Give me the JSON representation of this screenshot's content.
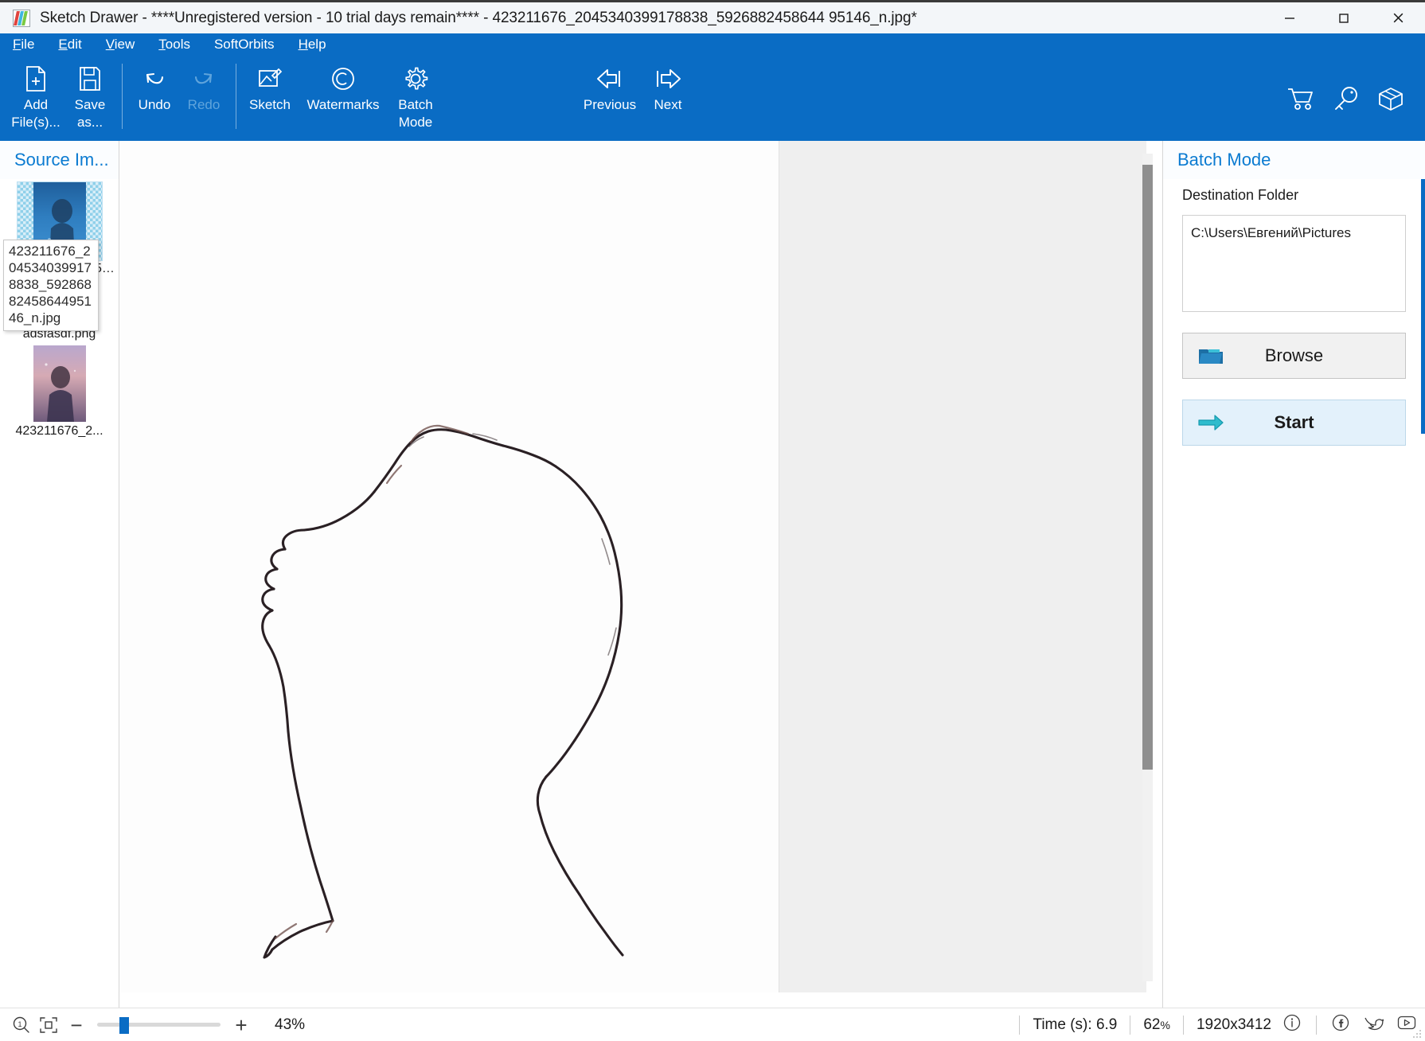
{
  "window": {
    "title": "Sketch Drawer - ****Unregistered version - 10 trial days remain**** - 423211676_2045340399178838_5926882458644951 46_n.jpg*",
    "title_full": "Sketch Drawer - ****Unregistered version - 10 trial days remain**** - 423211676_2045340399178838_5926882458644 95146_n.jpg*",
    "app_icon": "sketch-drawer-logo-icon",
    "minimize": "—",
    "maximize": "□",
    "close": "✕"
  },
  "menubar": {
    "items": [
      {
        "label": "File",
        "accel": "F"
      },
      {
        "label": "Edit",
        "accel": "E"
      },
      {
        "label": "View",
        "accel": "V"
      },
      {
        "label": "Tools",
        "accel": "T"
      },
      {
        "label": "SoftOrbits",
        "accel": ""
      },
      {
        "label": "Help",
        "accel": "H"
      }
    ]
  },
  "toolbar": {
    "add_files": "Add\nFile(s)...",
    "save_as": "Save\nas...",
    "undo": "Undo",
    "redo": "Redo",
    "sketch": "Sketch",
    "watermarks": "Watermarks",
    "batch_mode": "Batch\nMode",
    "previous": "Previous",
    "next": "Next",
    "right_icons": [
      "cart-icon",
      "key-icon",
      "box-icon"
    ]
  },
  "sidebar": {
    "title": "Source Im...",
    "thumbnails": [
      {
        "caption": "423211676_204534039917883...",
        "selected": true
      },
      {
        "caption": "adsfasdf.png",
        "selected": false
      },
      {
        "caption": "423211676_2...",
        "selected": false
      }
    ],
    "tooltip": "423211676_2045340399178838_5928688245864495146_n.jpg"
  },
  "panel": {
    "title": "Batch Mode",
    "destination_label": "Destination Folder",
    "destination_value": "C:\\Users\\Евгений\\Pictures",
    "browse_label": "Browse",
    "browse_icon": "folder-icon",
    "start_label": "Start",
    "start_icon": "arrow-right-icon"
  },
  "statusbar": {
    "zoom_icon": "zoom-100-icon",
    "fit_icon": "fit-to-window-icon",
    "zoom_out": "−",
    "zoom_in": "+",
    "zoom_percent": "43%",
    "slider_value": 18,
    "time": "Time (s): 6.9",
    "progress_percent": "62",
    "progress_percent_suffix": "%",
    "dimensions": "1920x3412",
    "icons": [
      "info-icon",
      "facebook-icon",
      "twitter-icon",
      "youtube-icon"
    ]
  },
  "colors": {
    "accent": "#0a6cc4",
    "link": "#0b7bd1",
    "start_button_bg": "#e3f1fb",
    "canvas_gray": "#efefef"
  }
}
